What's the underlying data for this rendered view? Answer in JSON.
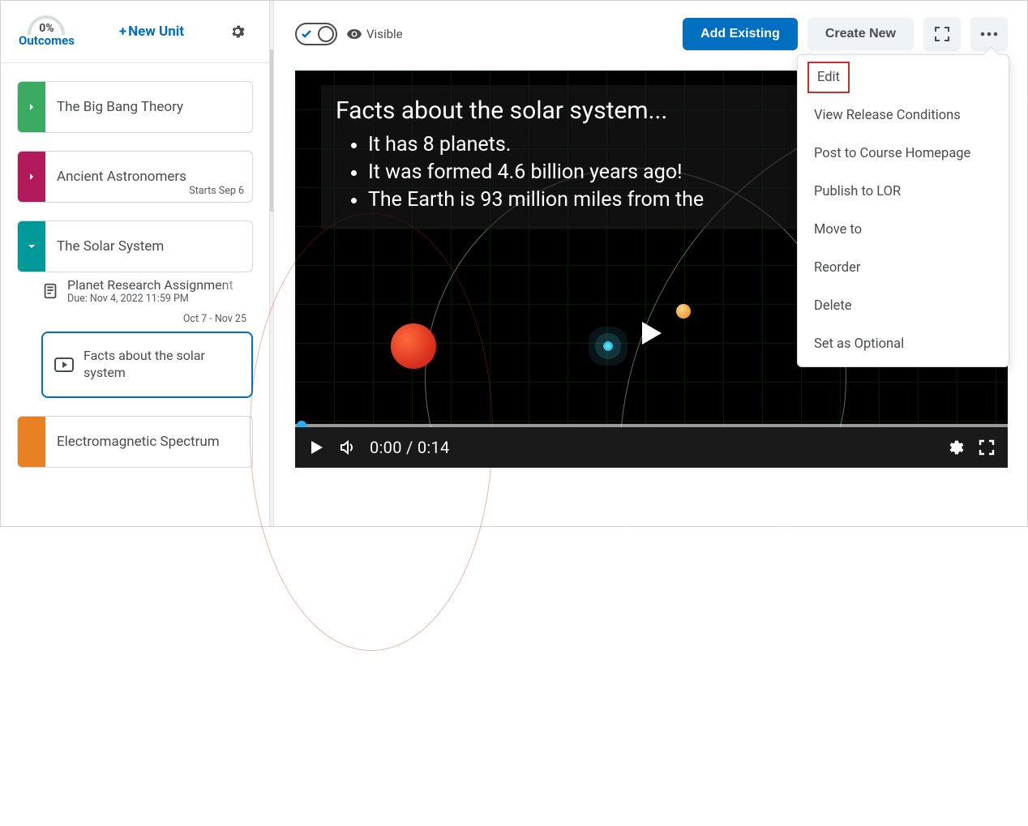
{
  "sidebar": {
    "outcomes_pct": "0%",
    "outcomes_label": "Outcomes",
    "new_unit_label": "New Unit",
    "units": [
      {
        "title": "The Big Bang Theory",
        "color": "#3cab62"
      },
      {
        "title": "Ancient Astronomers",
        "color": "#b1195a",
        "sub": "Starts Sep 6"
      },
      {
        "title": "The Solar System",
        "color": "#009999"
      },
      {
        "title": "Electromagnetic Spectrum",
        "color": "#e88024"
      }
    ],
    "assignment": {
      "title": "Planet Research Assignment",
      "due": "Due: Nov 4, 2022 11:59 PM",
      "dates": "Oct 7 - Nov 25"
    },
    "selected": {
      "title": "Facts about the solar system"
    }
  },
  "toolbar": {
    "visible_label": "Visible",
    "add_existing": "Add Existing",
    "create_new": "Create New"
  },
  "dropdown": {
    "items": [
      "Edit",
      "View Release Conditions",
      "Post to Course Homepage",
      "Publish to LOR",
      "Move to",
      "Reorder",
      "Delete",
      "Set as Optional"
    ]
  },
  "video": {
    "heading": "Facts about the solar system...",
    "bullets": [
      "It has 8 planets.",
      "It was formed 4.6 billion years ago!",
      "The Earth is 93 million miles from the"
    ],
    "time": "0:00 / 0:14"
  }
}
